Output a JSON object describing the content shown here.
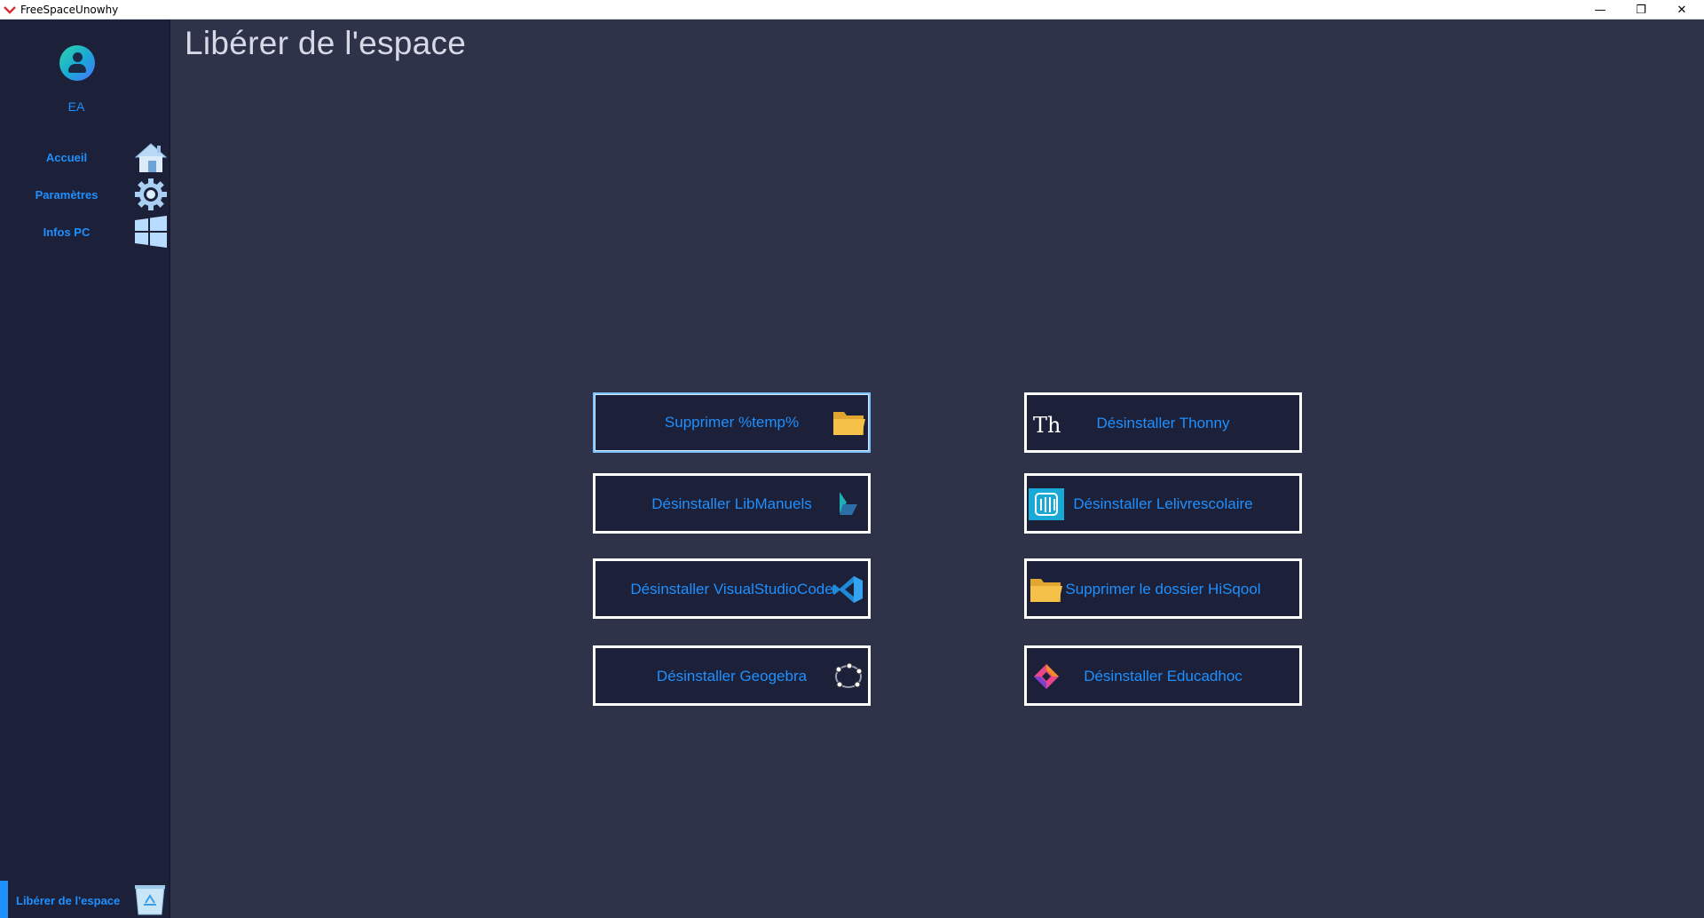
{
  "window": {
    "title": "FreeSpaceUnowhy",
    "minimize": "—",
    "maximize": "❐",
    "close": "✕"
  },
  "sidebar": {
    "user_initials": "EA",
    "items": [
      {
        "label": "Accueil",
        "icon": "home-icon"
      },
      {
        "label": "Paramètres",
        "icon": "gear-icon"
      },
      {
        "label": "Infos PC",
        "icon": "windows-icon"
      }
    ],
    "active_item": {
      "label": "Libérer de l'espace",
      "icon": "recycle-bin-icon"
    }
  },
  "main": {
    "title": "Libérer de l'espace",
    "actions": [
      {
        "label": "Supprimer %temp%",
        "icon": "folder-icon"
      },
      {
        "label": "Désinstaller Thonny",
        "icon": "thonny-icon"
      },
      {
        "label": "Désinstaller LibManuels",
        "icon": "libmanuels-icon"
      },
      {
        "label": "Désinstaller Lelivrescolaire",
        "icon": "lelivrescolaire-icon"
      },
      {
        "label": "Désinstaller VisualStudioCode",
        "icon": "vscode-icon"
      },
      {
        "label": "Supprimer le dossier HiSqool",
        "icon": "folder-icon"
      },
      {
        "label": "Désinstaller Geogebra",
        "icon": "geogebra-icon"
      },
      {
        "label": "Désinstaller Educadhoc",
        "icon": "educadhoc-icon"
      }
    ]
  },
  "colors": {
    "accent": "#1e90ff",
    "sidebar_bg": "#1c2039",
    "content_bg": "#2e3349",
    "button_border": "#ffffff",
    "folder": "#f5c148"
  }
}
